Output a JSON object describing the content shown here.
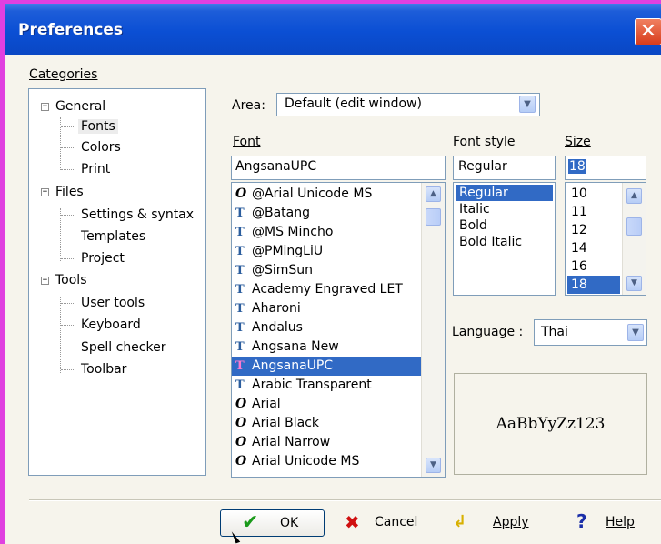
{
  "window": {
    "title": "Preferences",
    "close_glyph": "✕"
  },
  "categories": {
    "label": "Categories",
    "tree": [
      {
        "label": "General",
        "expanded": true,
        "children": [
          "Fonts",
          "Colors",
          "Print"
        ]
      },
      {
        "label": "Files",
        "expanded": true,
        "children": [
          "Settings & syntax",
          "Templates",
          "Project"
        ]
      },
      {
        "label": "Tools",
        "expanded": true,
        "children": [
          "User tools",
          "Keyboard",
          "Spell checker",
          "Toolbar"
        ]
      }
    ],
    "selected": "Fonts"
  },
  "area": {
    "label": "Area:",
    "value": "Default (edit window)"
  },
  "font": {
    "label": "Font",
    "value": "AngsanaUPC",
    "items": [
      {
        "name": "@Arial Unicode MS",
        "icon": "opentype-icon"
      },
      {
        "name": "@Batang",
        "icon": "truetype-icon"
      },
      {
        "name": "@MS Mincho",
        "icon": "truetype-icon"
      },
      {
        "name": "@PMingLiU",
        "icon": "truetype-icon"
      },
      {
        "name": "@SimSun",
        "icon": "truetype-icon"
      },
      {
        "name": "Academy Engraved LET",
        "icon": "truetype-icon"
      },
      {
        "name": "Aharoni",
        "icon": "truetype-icon"
      },
      {
        "name": "Andalus",
        "icon": "truetype-icon"
      },
      {
        "name": "Angsana New",
        "icon": "truetype-icon"
      },
      {
        "name": "AngsanaUPC",
        "icon": "truetype-icon"
      },
      {
        "name": "Arabic Transparent",
        "icon": "truetype-icon"
      },
      {
        "name": "Arial",
        "icon": "opentype-icon"
      },
      {
        "name": "Arial Black",
        "icon": "opentype-icon"
      },
      {
        "name": "Arial Narrow",
        "icon": "opentype-icon"
      },
      {
        "name": "Arial Unicode MS",
        "icon": "opentype-icon"
      }
    ],
    "selected_index": 9
  },
  "font_style": {
    "label": "Font style",
    "value": "Regular",
    "items": [
      "Regular",
      "Italic",
      "Bold",
      "Bold Italic"
    ],
    "selected_index": 0
  },
  "size": {
    "label": "Size",
    "value": "18",
    "items": [
      "10",
      "11",
      "12",
      "14",
      "16",
      "18"
    ],
    "selected_index": 5
  },
  "language": {
    "label": "Language :",
    "value": "Thai"
  },
  "preview": {
    "sample": "AaBbYyZz123"
  },
  "buttons": {
    "ok": "OK",
    "cancel": "Cancel",
    "apply": "Apply",
    "help": "Help"
  },
  "colors": {
    "selection": "#316ac5",
    "titlebar": "#0b4fd4",
    "frame": "#e040e0"
  }
}
